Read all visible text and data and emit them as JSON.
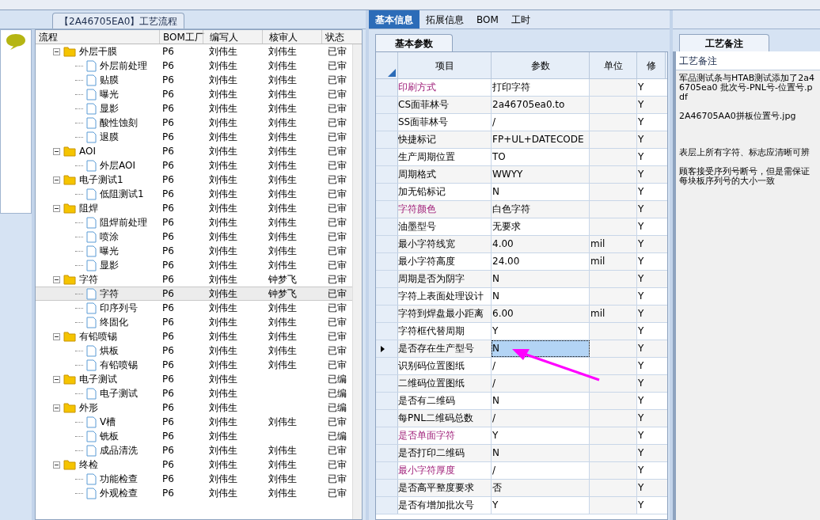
{
  "flow_tab": {
    "label": "【2A46705EA0】工艺流程"
  },
  "tree": {
    "columns": [
      "流程",
      "BOM工厂",
      "编写人",
      "核审人",
      "状态"
    ],
    "rows": [
      {
        "name": "外层干膜",
        "factory": "P6",
        "writer": "刘伟生",
        "reviewer": "刘伟生",
        "status": "已审",
        "selected": false,
        "children": [
          {
            "name": "外层前处理",
            "factory": "P6",
            "writer": "刘伟生",
            "reviewer": "刘伟生",
            "status": "已审",
            "selected": false
          },
          {
            "name": "贴膜",
            "factory": "P6",
            "writer": "刘伟生",
            "reviewer": "刘伟生",
            "status": "已审",
            "selected": false
          },
          {
            "name": "曝光",
            "factory": "P6",
            "writer": "刘伟生",
            "reviewer": "刘伟生",
            "status": "已审",
            "selected": false
          },
          {
            "name": "显影",
            "factory": "P6",
            "writer": "刘伟生",
            "reviewer": "刘伟生",
            "status": "已审",
            "selected": false
          },
          {
            "name": "酸性蚀刻",
            "factory": "P6",
            "writer": "刘伟生",
            "reviewer": "刘伟生",
            "status": "已审",
            "selected": false
          },
          {
            "name": "退膜",
            "factory": "P6",
            "writer": "刘伟生",
            "reviewer": "刘伟生",
            "status": "已审",
            "selected": false
          }
        ]
      },
      {
        "name": "AOI",
        "factory": "P6",
        "writer": "刘伟生",
        "reviewer": "刘伟生",
        "status": "已审",
        "selected": false,
        "children": [
          {
            "name": "外层AOI",
            "factory": "P6",
            "writer": "刘伟生",
            "reviewer": "刘伟生",
            "status": "已审",
            "selected": false
          }
        ]
      },
      {
        "name": "电子测试1",
        "factory": "P6",
        "writer": "刘伟生",
        "reviewer": "刘伟生",
        "status": "已审",
        "selected": false,
        "children": [
          {
            "name": "低阻测试1",
            "factory": "P6",
            "writer": "刘伟生",
            "reviewer": "刘伟生",
            "status": "已审",
            "selected": false
          }
        ]
      },
      {
        "name": "阻焊",
        "factory": "P6",
        "writer": "刘伟生",
        "reviewer": "刘伟生",
        "status": "已审",
        "selected": false,
        "children": [
          {
            "name": "阻焊前处理",
            "factory": "P6",
            "writer": "刘伟生",
            "reviewer": "刘伟生",
            "status": "已审",
            "selected": false
          },
          {
            "name": "喷涂",
            "factory": "P6",
            "writer": "刘伟生",
            "reviewer": "刘伟生",
            "status": "已审",
            "selected": false
          },
          {
            "name": "曝光",
            "factory": "P6",
            "writer": "刘伟生",
            "reviewer": "刘伟生",
            "status": "已审",
            "selected": false
          },
          {
            "name": "显影",
            "factory": "P6",
            "writer": "刘伟生",
            "reviewer": "刘伟生",
            "status": "已审",
            "selected": false
          }
        ]
      },
      {
        "name": "字符",
        "factory": "P6",
        "writer": "刘伟生",
        "reviewer": "钟梦飞",
        "status": "已审",
        "selected": false,
        "children": [
          {
            "name": "字符",
            "factory": "P6",
            "writer": "刘伟生",
            "reviewer": "钟梦飞",
            "status": "已审",
            "selected": true
          },
          {
            "name": "印序列号",
            "factory": "P6",
            "writer": "刘伟生",
            "reviewer": "刘伟生",
            "status": "已审",
            "selected": false
          },
          {
            "name": "终固化",
            "factory": "P6",
            "writer": "刘伟生",
            "reviewer": "刘伟生",
            "status": "已审",
            "selected": false
          }
        ]
      },
      {
        "name": "有铅喷锡",
        "factory": "P6",
        "writer": "刘伟生",
        "reviewer": "刘伟生",
        "status": "已审",
        "selected": false,
        "children": [
          {
            "name": "烘板",
            "factory": "P6",
            "writer": "刘伟生",
            "reviewer": "刘伟生",
            "status": "已审",
            "selected": false
          },
          {
            "name": "有铅喷锡",
            "factory": "P6",
            "writer": "刘伟生",
            "reviewer": "刘伟生",
            "status": "已审",
            "selected": false
          }
        ]
      },
      {
        "name": "电子测试",
        "factory": "P6",
        "writer": "刘伟生",
        "status": "已编",
        "selected": false,
        "children": [
          {
            "name": "电子测试",
            "factory": "P6",
            "writer": "刘伟生",
            "status": "已编",
            "selected": false
          }
        ]
      },
      {
        "name": "外形",
        "factory": "P6",
        "writer": "刘伟生",
        "status": "已编",
        "selected": false,
        "children": [
          {
            "name": "V槽",
            "factory": "P6",
            "writer": "刘伟生",
            "reviewer": "刘伟生",
            "status": "已审",
            "selected": false
          },
          {
            "name": "铣板",
            "factory": "P6",
            "writer": "刘伟生",
            "status": "已编",
            "selected": false
          },
          {
            "name": "成品清洗",
            "factory": "P6",
            "writer": "刘伟生",
            "reviewer": "刘伟生",
            "status": "已审",
            "selected": false
          }
        ]
      },
      {
        "name": "终检",
        "factory": "P6",
        "writer": "刘伟生",
        "reviewer": "刘伟生",
        "status": "已审",
        "selected": false,
        "children": [
          {
            "name": "功能检查",
            "factory": "P6",
            "writer": "刘伟生",
            "reviewer": "刘伟生",
            "status": "已审",
            "selected": false
          },
          {
            "name": "外观检查",
            "factory": "P6",
            "writer": "刘伟生",
            "reviewer": "刘伟生",
            "status": "已审",
            "selected": false
          }
        ]
      }
    ]
  },
  "tabs": [
    {
      "label": "基本信息",
      "selected": true
    },
    {
      "label": "拓展信息",
      "selected": false
    },
    {
      "label": "BOM",
      "selected": false
    },
    {
      "label": "工时",
      "selected": false
    }
  ],
  "sub_tab": {
    "label": "基本参数"
  },
  "grid": {
    "columns": [
      "项目",
      "参数",
      "单位",
      "修"
    ],
    "rows": [
      {
        "item": "印刷方式",
        "value": "打印字符",
        "unit": "",
        "modified": "Y",
        "highlighted": true,
        "selected": false
      },
      {
        "item": "CS面菲林号",
        "value": "2a46705ea0.to",
        "unit": "",
        "modified": "Y",
        "highlighted": false,
        "selected": false
      },
      {
        "item": "SS面菲林号",
        "value": "/",
        "unit": "",
        "modified": "Y",
        "highlighted": false,
        "selected": false
      },
      {
        "item": "快捷标记",
        "value": "FP+UL+DATECODE",
        "unit": "",
        "modified": "Y",
        "highlighted": false,
        "selected": false
      },
      {
        "item": "生产周期位置",
        "value": "TO",
        "unit": "",
        "modified": "Y",
        "highlighted": false,
        "selected": false
      },
      {
        "item": "周期格式",
        "value": "WWYY",
        "unit": "",
        "modified": "Y",
        "highlighted": false,
        "selected": false
      },
      {
        "item": "加无铅标记",
        "value": "N",
        "unit": "",
        "modified": "Y",
        "highlighted": false,
        "selected": false
      },
      {
        "item": "字符颜色",
        "value": "白色字符",
        "unit": "",
        "modified": "Y",
        "highlighted": true,
        "selected": false
      },
      {
        "item": "油墨型号",
        "value": "无要求",
        "unit": "",
        "modified": "Y",
        "highlighted": false,
        "selected": false
      },
      {
        "item": "最小字符线宽",
        "value": "4.00",
        "unit": "mil",
        "modified": "Y",
        "highlighted": false,
        "selected": false
      },
      {
        "item": "最小字符高度",
        "value": "24.00",
        "unit": "mil",
        "modified": "Y",
        "highlighted": false,
        "selected": false
      },
      {
        "item": "周期是否为阴字",
        "value": "N",
        "unit": "",
        "modified": "Y",
        "highlighted": false,
        "selected": false
      },
      {
        "item": "字符上表面处理设计",
        "value": "N",
        "unit": "",
        "modified": "Y",
        "highlighted": false,
        "selected": false
      },
      {
        "item": "字符到焊盘最小距离",
        "value": "6.00",
        "unit": "mil",
        "modified": "Y",
        "highlighted": false,
        "selected": false
      },
      {
        "item": "字符框代替周期",
        "value": "Y",
        "unit": "",
        "modified": "Y",
        "highlighted": false,
        "selected": false
      },
      {
        "item": "是否存在生产型号",
        "value": "N",
        "unit": "",
        "modified": "Y",
        "highlighted": false,
        "selected": true
      },
      {
        "item": "识别码位置图纸",
        "value": "/",
        "unit": "",
        "modified": "Y",
        "highlighted": false,
        "selected": false
      },
      {
        "item": "二维码位置图纸",
        "value": "/",
        "unit": "",
        "modified": "Y",
        "highlighted": false,
        "selected": false
      },
      {
        "item": "是否有二维码",
        "value": "N",
        "unit": "",
        "modified": "Y",
        "highlighted": false,
        "selected": false
      },
      {
        "item": "每PNL二维码总数",
        "value": "/",
        "unit": "",
        "modified": "Y",
        "highlighted": false,
        "selected": false
      },
      {
        "item": "是否单面字符",
        "value": "Y",
        "unit": "",
        "modified": "Y",
        "highlighted": true,
        "selected": false
      },
      {
        "item": "是否打印二维码",
        "value": "N",
        "unit": "",
        "modified": "Y",
        "highlighted": false,
        "selected": false
      },
      {
        "item": "最小字符厚度",
        "value": "/",
        "unit": "",
        "modified": "Y",
        "highlighted": true,
        "selected": false
      },
      {
        "item": "是否高平整度要求",
        "value": "否",
        "unit": "",
        "modified": "Y",
        "highlighted": false,
        "selected": false
      },
      {
        "item": "是否有增加批次号",
        "value": "Y",
        "unit": "",
        "modified": "Y",
        "highlighted": false,
        "selected": false
      }
    ]
  },
  "notes": {
    "tab": "工艺备注",
    "header": "工艺备注",
    "paragraphs": [
      "军品测试条与HTAB测试添加了2a46705ea0 批次号-PNL号-位置号.pdf",
      "2A46705AA0拼板位置号.jpg",
      "表层上所有字符、标志应清晰可辨",
      "顾客接受序列号断号，但是需保证每块板序列号的大小一致"
    ]
  }
}
